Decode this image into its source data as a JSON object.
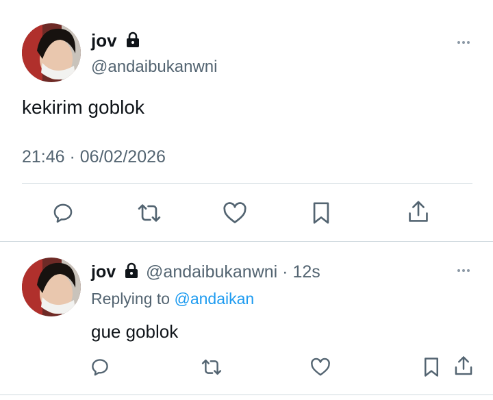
{
  "tweet": {
    "display_name": "jov",
    "handle": "@andaibukanwni",
    "text": "kekirim goblok",
    "timestamp": "21:46 · 06/02/2026",
    "protected_icon": "lock-icon",
    "actions": [
      "reply-icon",
      "retweet-icon",
      "like-icon",
      "bookmark-icon",
      "share-icon"
    ]
  },
  "reply": {
    "display_name": "jov",
    "handle": "@andaibukanwni",
    "separator": "·",
    "age": "12s",
    "replying_to_prefix": "Replying to",
    "replying_to_handle": "@andaikan",
    "text": "gue goblok",
    "actions": [
      "reply-icon",
      "retweet-icon",
      "like-icon",
      "bookmark-icon",
      "share-icon"
    ]
  },
  "colors": {
    "text": "#0f1419",
    "muted": "#536471",
    "link": "#1d9bf0",
    "divider": "#cfd9de"
  }
}
